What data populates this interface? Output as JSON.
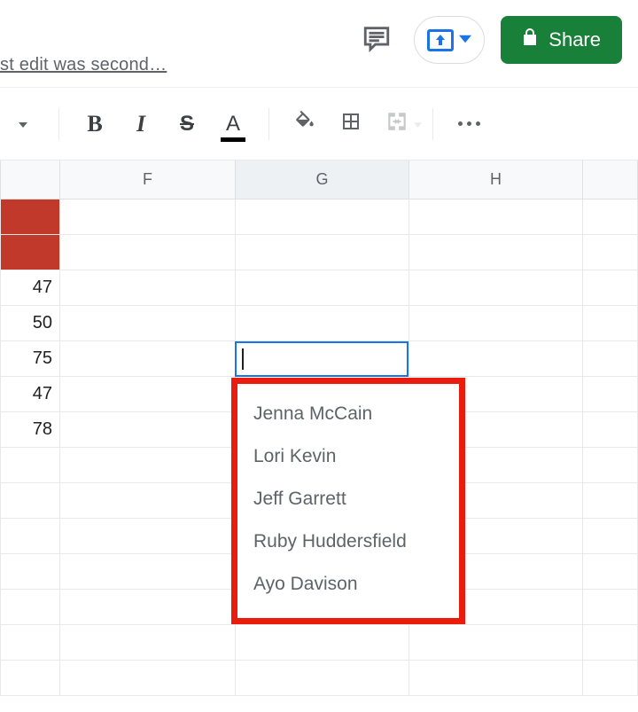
{
  "header": {
    "last_edit_text": "st edit was second…",
    "share_label": "Share"
  },
  "toolbar": {
    "bold_label": "B",
    "italic_label": "I",
    "strike_label": "S",
    "textcolor_label": "A"
  },
  "columns": {
    "F": "F",
    "G": "G",
    "H": "H"
  },
  "data_e": [
    "",
    "",
    "47",
    "50",
    "75",
    "47",
    "78",
    "",
    "",
    "",
    "",
    "",
    "",
    ""
  ],
  "active_cell": {
    "address": "G5",
    "value": ""
  },
  "autocomplete": {
    "items": [
      {
        "label": "Jenna McCain"
      },
      {
        "label": "Lori Kevin"
      },
      {
        "label": "Jeff Garrett"
      },
      {
        "label": "Ruby Huddersfield"
      },
      {
        "label": "Ayo Davison"
      }
    ]
  }
}
